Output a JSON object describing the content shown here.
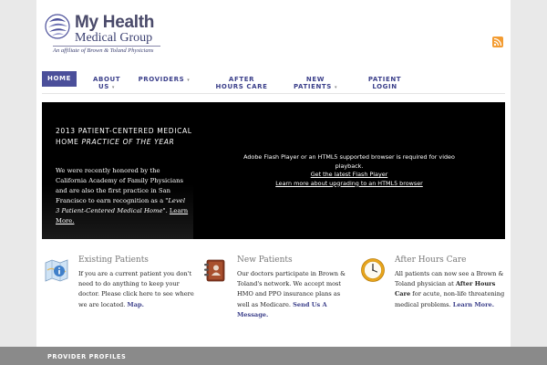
{
  "brand": {
    "line1": "My Health",
    "line2": "Medical Group",
    "tagline": "An affiliate of Brown & Toland Physicians",
    "accent": "#4b4f9a"
  },
  "nav": {
    "home": "HOME",
    "about": "ABOUT US",
    "providers": "PROVIDERS",
    "after_hours": "AFTER HOURS CARE",
    "new_patients": "NEW PATIENTS",
    "patient_login": "PATIENT LOGIN",
    "caret": "▾"
  },
  "hero": {
    "title_plain": "2013 PATIENT-CENTERED MEDICAL HOME ",
    "title_italic": "PRACTICE OF THE YEAR",
    "body_1": "We were recently honored by the California Academy of Family Physicians and are also the first practice in San Francisco to earn recognition as a ",
    "body_quote": "\"Level 3 Patient-Centered Medical Home\"",
    "body_2": ". ",
    "learn_more": "Learn More.",
    "flash_msg": "Adobe Flash Player or an HTML5 supported browser is required for video playback.",
    "flash_link1": "Get the latest Flash Player",
    "flash_link2": "Learn more about upgrading to an HTML5 browser"
  },
  "columns": {
    "existing": {
      "title": "Existing Patients",
      "text": "If you are a current patient you don't need to do anything to keep your doctor.  Please click here to see where we are located.  ",
      "link": "Map."
    },
    "new": {
      "title": "New Patients",
      "text": "Our doctors participate in Brown & Toland's network. We accept most HMO and PPO insurance plans as well as Medicare. ",
      "link": "Send Us A Message."
    },
    "after": {
      "title": "After Hours Care",
      "text_1": "All patients can now see a Brown & Toland physician at  ",
      "bold": "After Hours Care",
      "text_2": "  for acute, non-life threatening medical problems. ",
      "link": "Learn More."
    }
  },
  "footer": {
    "label": "PROVIDER PROFILES"
  },
  "icons": {
    "logo": "swirl-logo-icon",
    "rss": "rss-icon",
    "existing": "map-info-icon",
    "new": "address-book-icon",
    "after": "clock-icon"
  }
}
